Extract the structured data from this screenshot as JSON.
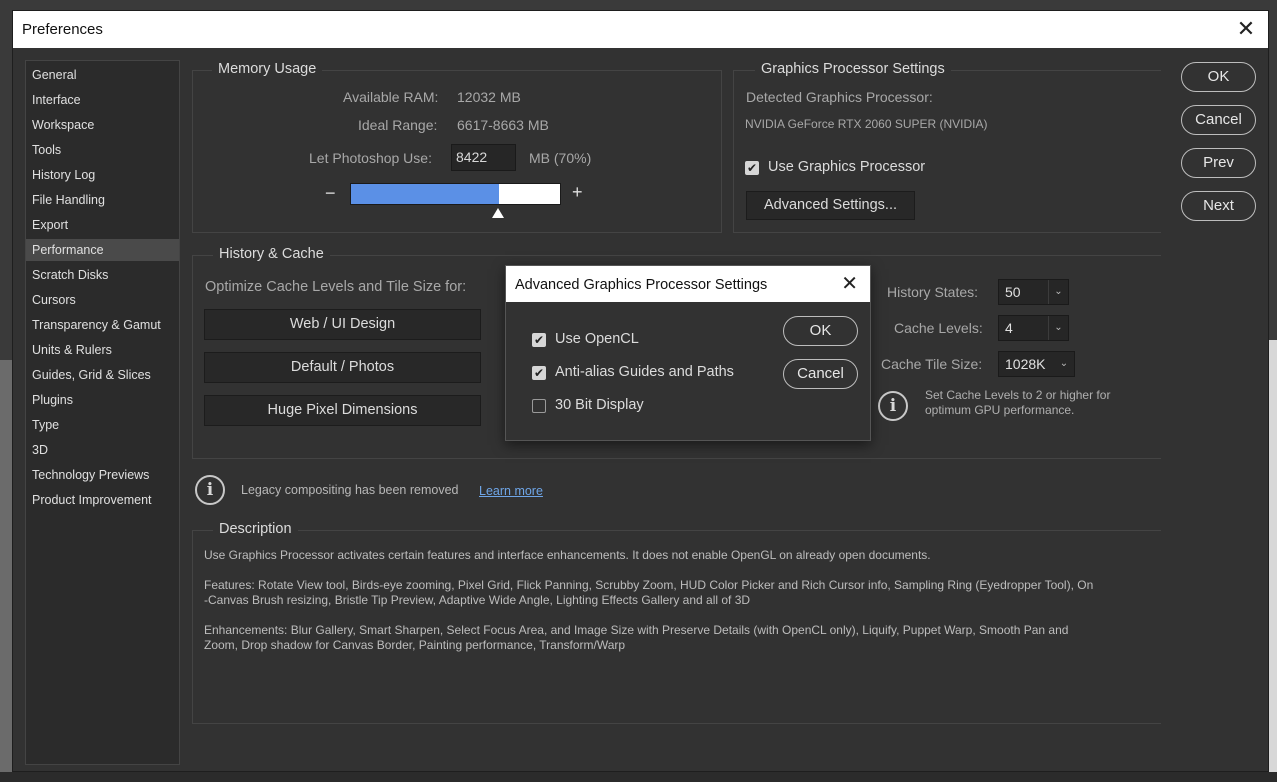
{
  "window": {
    "title": "Preferences",
    "close_glyph": "✕"
  },
  "sidebar": {
    "items": [
      {
        "label": "General"
      },
      {
        "label": "Interface"
      },
      {
        "label": "Workspace"
      },
      {
        "label": "Tools"
      },
      {
        "label": "History Log"
      },
      {
        "label": "File Handling"
      },
      {
        "label": "Export"
      },
      {
        "label": "Performance",
        "active": true
      },
      {
        "label": "Scratch Disks"
      },
      {
        "label": "Cursors"
      },
      {
        "label": "Transparency & Gamut"
      },
      {
        "label": "Units & Rulers"
      },
      {
        "label": "Guides, Grid & Slices"
      },
      {
        "label": "Plugins"
      },
      {
        "label": "Type"
      },
      {
        "label": "3D"
      },
      {
        "label": "Technology Previews"
      },
      {
        "label": "Product Improvement"
      }
    ]
  },
  "memory": {
    "title": "Memory Usage",
    "available_label": "Available RAM:",
    "available_value": "12032 MB",
    "ideal_label": "Ideal Range:",
    "ideal_value": "6617-8663 MB",
    "use_label": "Let Photoshop Use:",
    "use_value": "8422",
    "use_unit": "MB (70%)",
    "slider_percent": 70,
    "minus": "−",
    "plus": "+"
  },
  "gpu": {
    "title": "Graphics Processor Settings",
    "detected_label": "Detected Graphics Processor:",
    "detected_value": "NVIDIA GeForce RTX 2060 SUPER (NVIDIA)",
    "use_gpu_label": "Use Graphics Processor",
    "use_gpu_checked": true,
    "advanced_button": "Advanced Settings..."
  },
  "right_buttons": {
    "ok": "OK",
    "cancel": "Cancel",
    "prev": "Prev",
    "next": "Next"
  },
  "history_cache": {
    "title": "History & Cache",
    "optimize_label": "Optimize Cache Levels and Tile Size for:",
    "preset_web": "Web / UI Design",
    "preset_default": "Default / Photos",
    "preset_huge": "Huge Pixel Dimensions",
    "history_states_label": "History States:",
    "history_states_value": "50",
    "cache_levels_label": "Cache Levels:",
    "cache_levels_value": "4",
    "tile_size_label": "Cache Tile Size:",
    "tile_size_value": "1028K",
    "hint_line1": "Set Cache Levels to 2 or higher for",
    "hint_line2": "optimum GPU performance."
  },
  "legacy": {
    "text": "Legacy compositing has been removed",
    "link": "Learn more",
    "link_color": "#6fa6e8"
  },
  "description": {
    "title": "Description",
    "para1": "Use Graphics Processor activates certain features and interface enhancements. It does not enable OpenGL on already open documents.",
    "para2_line1": "Features: Rotate View tool, Birds-eye zooming, Pixel Grid, Flick Panning, Scrubby Zoom, HUD Color Picker and Rich Cursor info, Sampling Ring (Eyedropper Tool), On",
    "para2_line2": "-Canvas Brush resizing, Bristle Tip Preview, Adaptive Wide Angle, Lighting Effects Gallery and all of 3D",
    "para3_line1": "Enhancements: Blur Gallery, Smart Sharpen, Select Focus Area, and Image Size with Preserve Details (with OpenCL only), Liquify, Puppet Warp, Smooth Pan and",
    "para3_line2": "Zoom, Drop shadow for Canvas Border, Painting performance, Transform/Warp"
  },
  "modal": {
    "title": "Advanced Graphics Processor Settings",
    "close_glyph": "✕",
    "opencl_label": "Use OpenCL",
    "opencl_checked": true,
    "antialias_label": "Anti-alias Guides and Paths",
    "antialias_checked": true,
    "bit30_label": "30 Bit Display",
    "bit30_checked": false,
    "ok": "OK",
    "cancel": "Cancel"
  },
  "colors": {
    "slider_fill": "#5b90e6",
    "checkmark": "✔"
  }
}
